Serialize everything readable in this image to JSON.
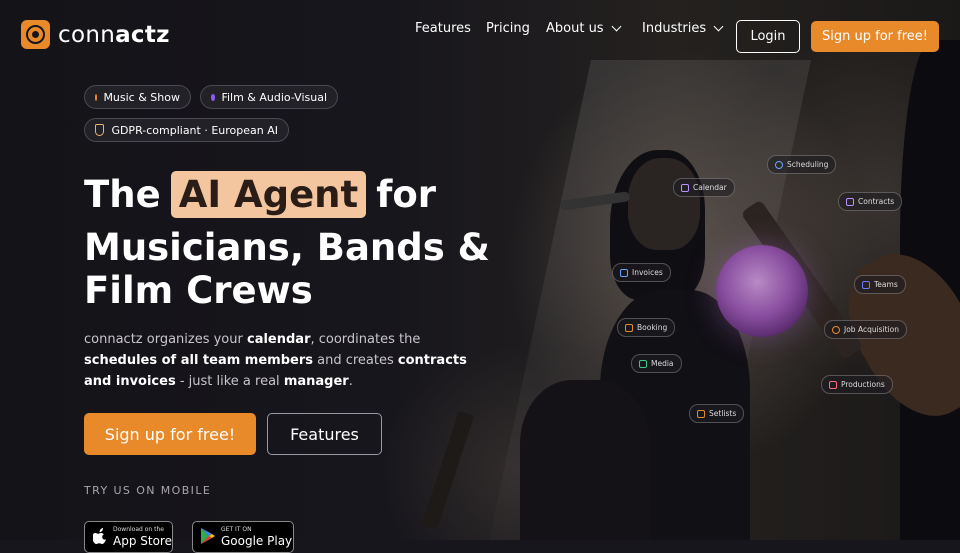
{
  "brand": {
    "name_light": "conn",
    "name_bold": "actz",
    "accent": "#e98a2a"
  },
  "nav": {
    "features": "Features",
    "pricing": "Pricing",
    "about": "About us",
    "industries": "Industries",
    "login": "Login",
    "signup": "Sign up for free!"
  },
  "badges": {
    "music": "Music & Show",
    "film": "Film & Audio-Visual",
    "gdpr": "GDPR-compliant · European AI",
    "music_color": "#e98a2a",
    "film_color": "#8b5cf6"
  },
  "hero": {
    "title_the": "The",
    "title_highlight": "AI Agent",
    "title_for": "for",
    "title_line2": "Musicians, Bands & Film Crews",
    "desc_parts": [
      "connactz organizes your ",
      "calendar",
      ", coordinates the ",
      "schedules of all team members",
      " and creates ",
      "contracts and invoices",
      " - just like a real ",
      "manager",
      "."
    ],
    "cta_primary": "Sign up for free!",
    "cta_secondary": "Features",
    "mobile_label": "TRY US ON MOBILE"
  },
  "stores": {
    "apple_small": "Download on the",
    "apple_big": "App Store",
    "google_small": "GET IT ON",
    "google_big": "Google Play"
  },
  "chips": {
    "scheduling": "Scheduling",
    "calendar": "Calendar",
    "contracts": "Contracts",
    "invoices": "Invoices",
    "teams": "Teams",
    "booking": "Booking",
    "job_acquisition": "Job Acquisition",
    "media": "Media",
    "productions": "Productions",
    "setlists": "Setlists"
  }
}
